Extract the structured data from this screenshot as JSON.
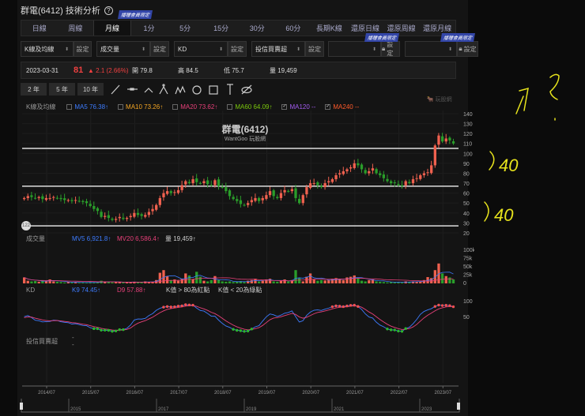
{
  "header": {
    "title": "群電(6412) 技術分析",
    "help": "?"
  },
  "badge": "播種會員限定",
  "tabs": [
    {
      "label": "日線"
    },
    {
      "label": "周線"
    },
    {
      "label": "月線",
      "active": true
    },
    {
      "label": "1分"
    },
    {
      "label": "5分"
    },
    {
      "label": "15分"
    },
    {
      "label": "30分"
    },
    {
      "label": "60分"
    },
    {
      "label": "長期K線"
    },
    {
      "label": "還原日線"
    },
    {
      "label": "還原周線"
    },
    {
      "label": "還原月線"
    }
  ],
  "selectors": [
    {
      "value": "K線及均線",
      "btn": "設定"
    },
    {
      "value": "成交量",
      "btn": "設定"
    },
    {
      "value": "KD",
      "btn": "設定"
    },
    {
      "value": "投信買賣超",
      "btn": "設定"
    },
    {
      "value": "",
      "btn": "設定"
    },
    {
      "value": "",
      "btn": "設定"
    }
  ],
  "info": {
    "date": "2023-03-31",
    "price": "81",
    "change": "▲ 2.1 (2.66%)",
    "open": "開 79.8",
    "high": "高 84.5",
    "low": "低 75.7",
    "volume": "量 19,459"
  },
  "range_buttons": [
    "2 年",
    "5 年",
    "10 年"
  ],
  "tools": [
    "line-tool",
    "horizontal-line-tool",
    "angle-tool",
    "wave-tool",
    "multi-wave-tool",
    "circle-tool",
    "rectangle-tool",
    "fib-tool",
    "hide-tool"
  ],
  "ma_legend": {
    "label": "K線及均線",
    "items": [
      {
        "text": "MA5 76.38↑",
        "color": "#3d7cff",
        "checked": false
      },
      {
        "text": "MA10 73.26↑",
        "color": "#f5a623",
        "checked": false
      },
      {
        "text": "MA20 73.62↑",
        "color": "#e8407a",
        "checked": false
      },
      {
        "text": "MA60 64.09↑",
        "color": "#7ac70c",
        "checked": false
      },
      {
        "text": "MA120 --",
        "color": "#a35cf0",
        "checked": true
      },
      {
        "text": "MA240 --",
        "color": "#ff5a2a",
        "checked": true
      }
    ]
  },
  "watermark": {
    "name": "群電(6412)",
    "sub": "WantGoo 玩股網",
    "logo": "玩股網"
  },
  "volume_legend": {
    "label": "成交量",
    "mv5": "MV5 6,921.8↑",
    "mv20": "MV20 6,586.4↑",
    "vol": "量 19,459↑"
  },
  "kd_legend": {
    "label": "KD",
    "k": "K9 74.45↑",
    "d": "D9 57.88↑",
    "note1": "K值 > 80為紅點",
    "note2": "K值 < 20為綠點"
  },
  "inst_legend": {
    "label": "投信買賣超",
    "value": "--"
  },
  "annotation_marker": "122",
  "colors": {
    "up": "#f0614f",
    "down": "#2a9d2a",
    "k": "#3d7cff",
    "d": "#e8407a",
    "handwriting": "#e6e21c"
  },
  "handwriting": [
    "?",
    "40",
    "40"
  ],
  "chart_data": {
    "type": "candlestick",
    "start": "2014/01",
    "interval": "month",
    "closes": [
      55,
      57,
      56,
      55,
      56,
      54,
      55,
      55,
      56,
      55,
      54,
      53,
      53,
      52,
      53,
      52,
      51,
      50,
      47,
      44,
      42,
      36,
      37,
      35,
      33,
      34,
      36,
      34,
      35,
      37,
      40,
      38,
      37,
      38,
      41,
      44,
      48,
      55,
      60,
      62,
      60,
      61,
      63,
      68,
      72,
      70,
      74,
      71,
      70,
      72,
      69,
      68,
      73,
      67,
      66,
      62,
      57,
      54,
      52,
      49,
      48,
      50,
      53,
      55,
      52,
      55,
      58,
      62,
      57,
      55,
      60,
      63,
      62,
      64,
      55,
      50,
      58,
      66,
      70,
      70,
      68,
      66,
      70,
      72,
      74,
      78,
      80,
      82,
      84,
      86,
      90,
      88,
      84,
      80,
      82,
      85,
      80,
      78,
      75,
      72,
      70,
      70,
      68,
      67,
      72,
      70,
      74,
      75,
      78,
      80,
      81,
      88,
      108,
      118,
      112,
      115,
      113,
      110
    ],
    "volume_k": [
      18,
      8,
      6,
      7,
      5,
      9,
      7,
      12,
      6,
      5,
      4,
      3,
      4,
      3,
      3,
      2,
      3,
      2,
      4,
      3,
      3,
      8,
      5,
      4,
      3,
      4,
      5,
      3,
      4,
      3,
      5,
      4,
      3,
      6,
      4,
      5,
      10,
      32,
      40,
      22,
      10,
      12,
      8,
      14,
      30,
      24,
      12,
      35,
      20,
      8,
      6,
      10,
      22,
      10,
      6,
      5,
      6,
      4,
      5,
      7,
      4,
      8,
      10,
      14,
      6,
      8,
      12,
      14,
      6,
      5,
      8,
      12,
      6,
      10,
      40,
      16,
      6,
      20,
      30,
      12,
      8,
      10,
      9,
      10,
      14,
      16,
      12,
      10,
      18,
      20,
      24,
      16,
      8,
      6,
      10,
      12,
      6,
      5,
      4,
      3,
      4,
      3,
      3,
      3,
      6,
      5,
      6,
      5,
      6,
      10,
      19,
      16,
      40,
      60,
      30,
      22,
      18,
      12
    ],
    "price_axis": [
      140,
      130,
      120,
      110,
      100,
      90,
      80,
      70,
      60,
      50,
      40,
      30,
      20
    ],
    "volume_axis": [
      "100k",
      "75k",
      "50k",
      "25k",
      "0"
    ],
    "kd_axis": [
      "100",
      "50"
    ],
    "horizontal_lines": [
      105,
      67,
      27
    ],
    "x_ticks": [
      "2014/07",
      "2015/07",
      "2016/07",
      "2017/07",
      "2018/07",
      "2019/07",
      "2020/07",
      "2021/07",
      "2022/07",
      "2023/07"
    ],
    "navigator_labels": [
      "2015",
      "2017",
      "2019",
      "2021",
      "2023"
    ]
  }
}
